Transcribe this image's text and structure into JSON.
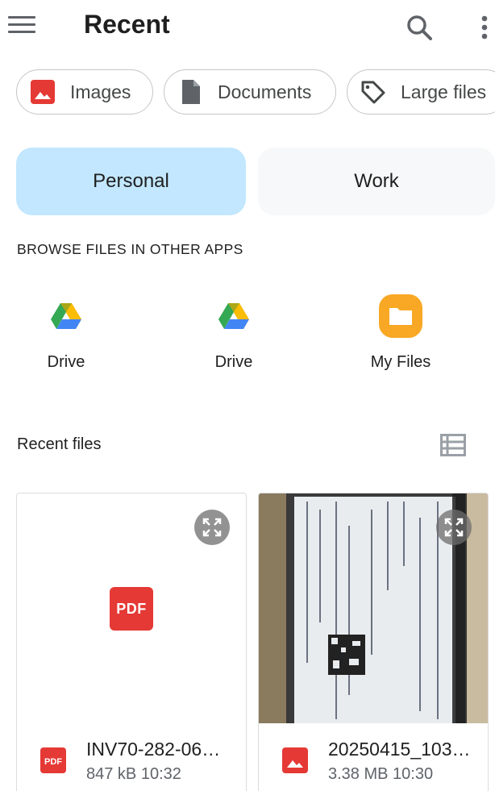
{
  "header": {
    "title": "Recent",
    "menu_icon": "menu-icon",
    "search_icon": "search-icon",
    "more_icon": "more-vert-icon"
  },
  "chips": [
    {
      "label": "Images",
      "icon": "image-icon",
      "color": "#e53935"
    },
    {
      "label": "Documents",
      "icon": "document-icon",
      "color": "#5f6368"
    },
    {
      "label": "Large files",
      "icon": "tag-icon",
      "color": "#444746"
    }
  ],
  "segments": {
    "personal": "Personal",
    "work": "Work",
    "selected": "Personal",
    "selected_color": "#c2e7ff"
  },
  "browse": {
    "header": "BROWSE FILES IN OTHER APPS",
    "apps": [
      {
        "label": "Drive",
        "icon": "google-drive-icon"
      },
      {
        "label": "Drive",
        "icon": "google-drive-icon"
      },
      {
        "label": "My Files",
        "icon": "folder-icon",
        "color": "#f9a825"
      }
    ]
  },
  "recent": {
    "title": "Recent files",
    "view_toggle_icon": "list-view-icon",
    "files": [
      {
        "name": "INV70-282-06…",
        "meta": "847 kB 10:32",
        "type_icon": "pdf-icon",
        "preview": "PDF"
      },
      {
        "name": "20250415_103…",
        "meta": "3.38 MB 10:30",
        "type_icon": "image-icon",
        "preview": "photo of document"
      }
    ]
  }
}
